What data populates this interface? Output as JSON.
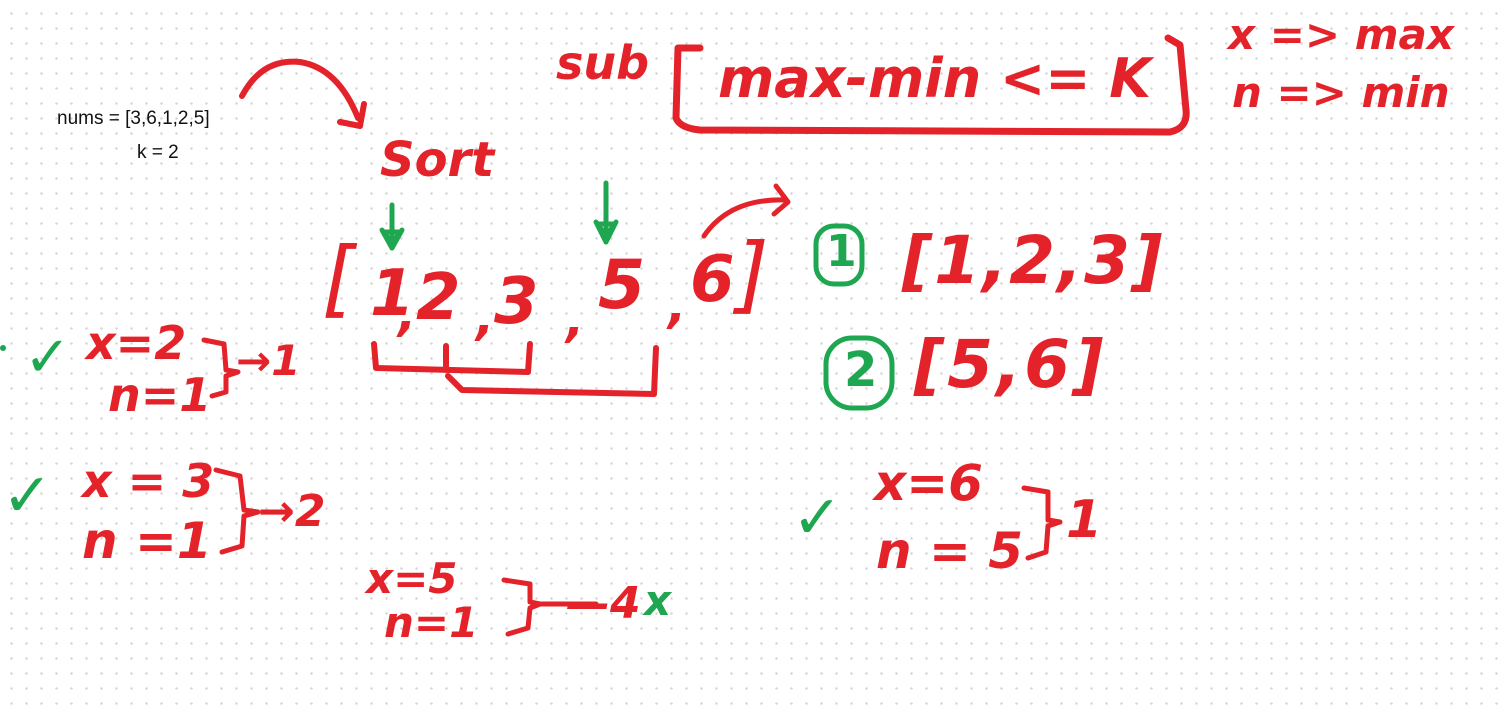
{
  "typed_text": {
    "nums_line": "nums = [3,6,1,2,5]",
    "k_line": "k = 2"
  },
  "handwriting": {
    "sub": "sub",
    "condition": "max-min <= K",
    "legend_x": "x => max",
    "legend_n": "n => min",
    "sort": "Sort",
    "sorted_array": {
      "open": "[",
      "items": [
        "1",
        "2",
        "3",
        "5",
        "6"
      ],
      "close": "]"
    },
    "groups": [
      {
        "number": "1",
        "set": "[1,2,3]"
      },
      {
        "number": "2",
        "set": "[5,6]"
      }
    ],
    "check1": {
      "x": "x=2",
      "n": "n=1",
      "result": "→1"
    },
    "check2": {
      "x": "x = 3",
      "n": "n =1",
      "result": "→2"
    },
    "check3": {
      "x": "x=5",
      "n": "n=1",
      "result": "—4",
      "mark": "x"
    },
    "check4": {
      "x": "x=6",
      "n": "n = 5",
      "result": "1"
    },
    "checkmark": "✓"
  },
  "colors": {
    "red_ink": "#e3222a",
    "green_ink": "#1fa650",
    "typed": "#111111"
  }
}
